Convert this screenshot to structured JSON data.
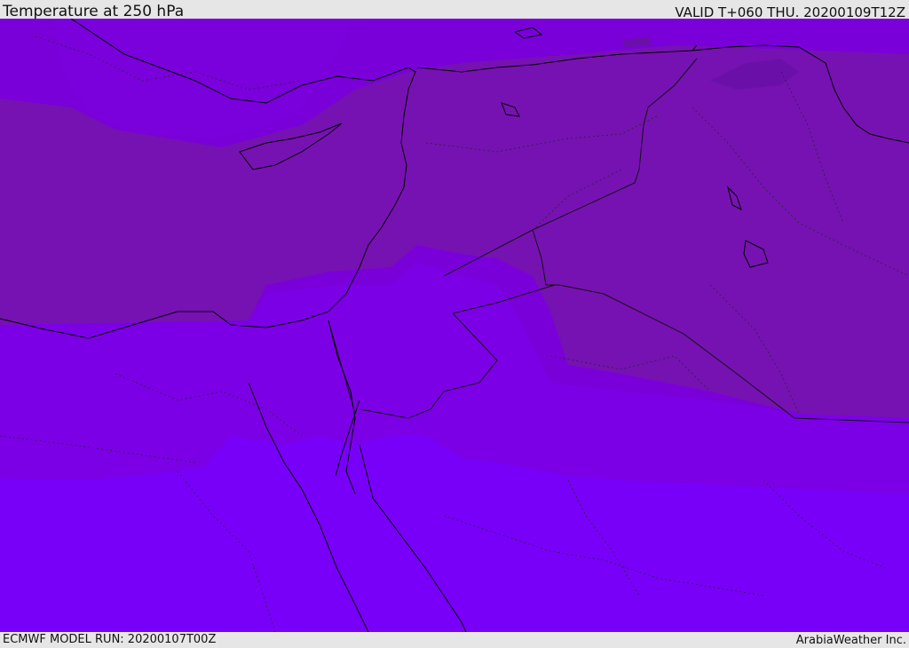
{
  "header": {
    "title": "Temperature at 250 hPa",
    "valid": "VALID T+060 THU. 20200109T12Z"
  },
  "footer": {
    "model_run": "ECMWF MODEL RUN: 20200107T00Z",
    "credit": "ArabiaWeather Inc."
  },
  "map": {
    "fill_colors": {
      "coldest": "#6a10a8",
      "cold": "#7612b2",
      "cool": "#7a00da",
      "mild": "#7c00e6",
      "warm": "#7800f8"
    },
    "line_colors": {
      "coast": "#000000",
      "border": "#111111"
    }
  }
}
